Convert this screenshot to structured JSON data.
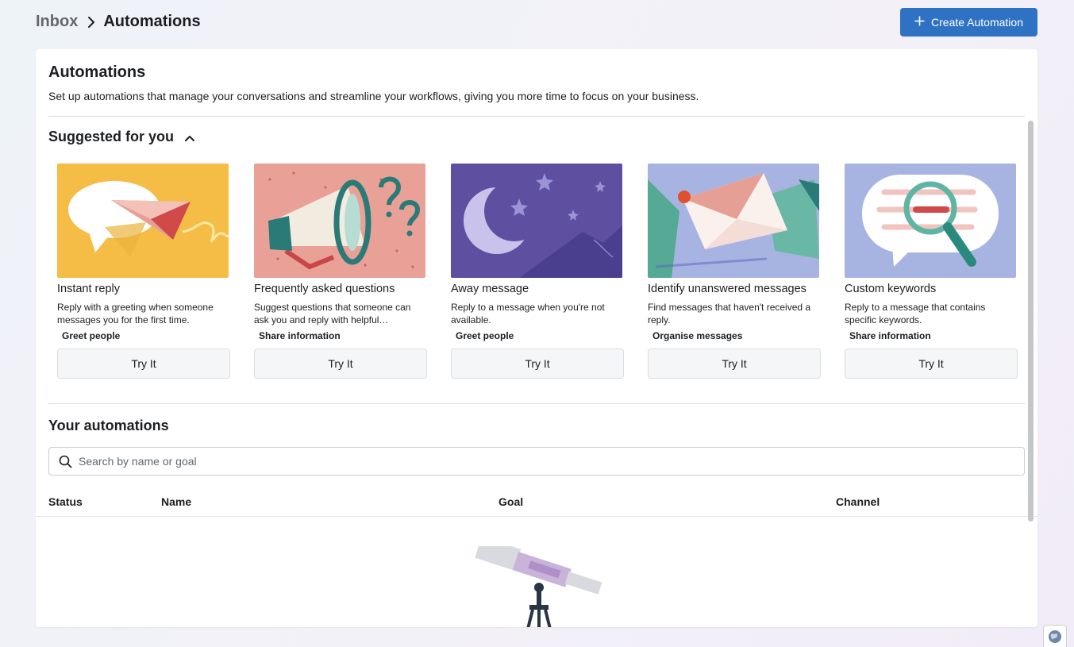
{
  "breadcrumb": {
    "root": "Inbox",
    "current": "Automations"
  },
  "header": {
    "create_label": "Create Automation"
  },
  "panel": {
    "title": "Automations",
    "description": "Set up automations that manage your conversations and streamline your workflows, giving you more time to focus on your business."
  },
  "suggested": {
    "heading": "Suggested for you",
    "cards": [
      {
        "title": "Instant reply",
        "description": "Reply with a greeting when someone messages you for the first time.",
        "tag": "Greet people",
        "button": "Try It"
      },
      {
        "title": "Frequently asked questions",
        "description": "Suggest questions that someone can ask you and reply with helpful…",
        "tag": "Share information",
        "button": "Try It"
      },
      {
        "title": "Away message",
        "description": "Reply to a message when you're not available.",
        "tag": "Greet people",
        "button": "Try It"
      },
      {
        "title": "Identify unanswered messages",
        "description": "Find messages that haven't received a reply.",
        "tag": "Organise messages",
        "button": "Try It"
      },
      {
        "title": "Custom keywords",
        "description": "Reply to a message that contains specific keywords.",
        "tag": "Share information",
        "button": "Try It"
      }
    ]
  },
  "your_automations": {
    "heading": "Your automations",
    "search_placeholder": "Search by name or goal",
    "columns": [
      "Status",
      "Name",
      "Goal",
      "Channel"
    ]
  },
  "colors": {
    "accent": "#2f72c4",
    "divider": "#dadde1",
    "button_bg": "#f5f6f7"
  }
}
